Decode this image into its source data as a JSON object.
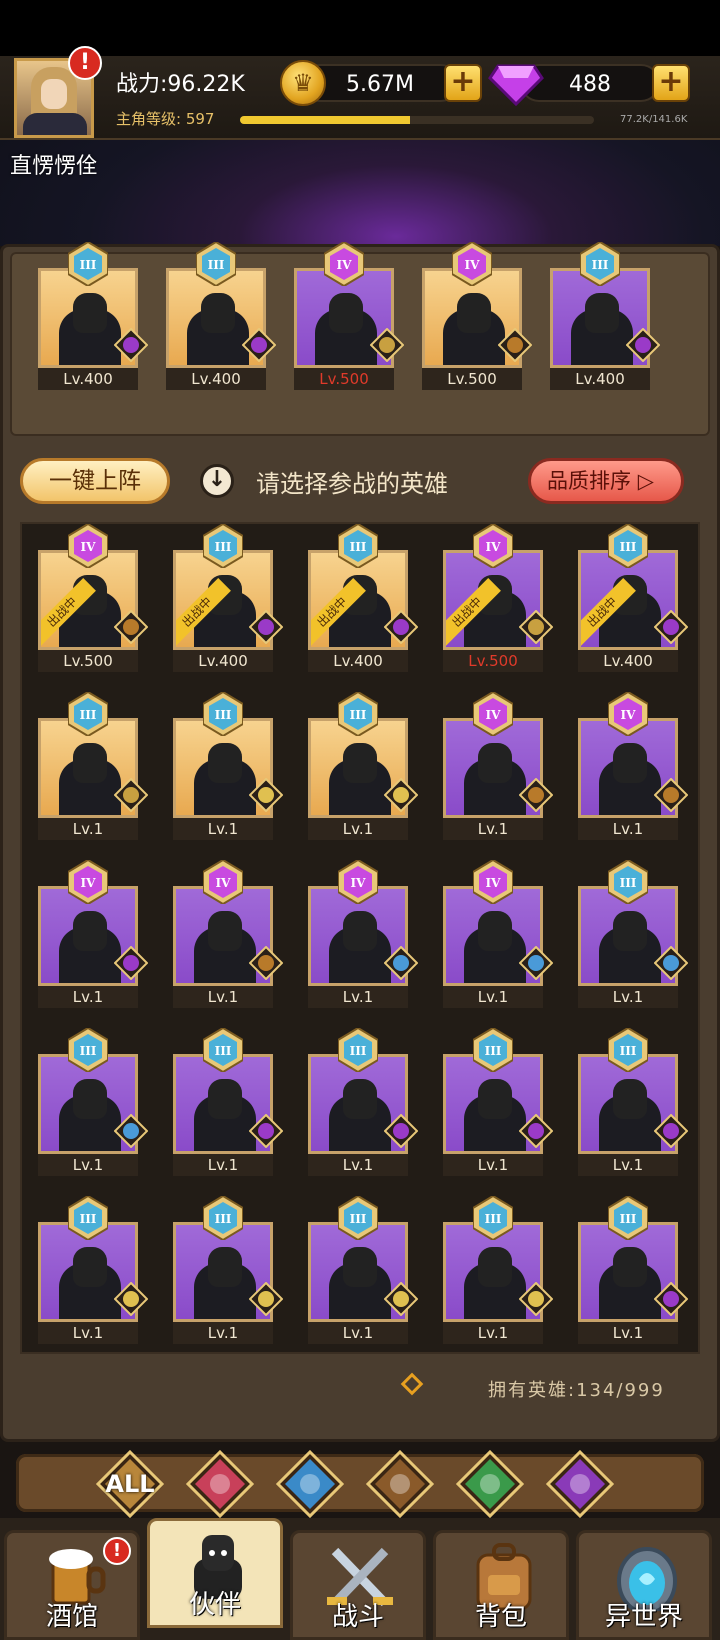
{
  "header": {
    "power_label": "战力:96.22K",
    "level_label": "主角等级: 597",
    "xp_progress": 0.48,
    "xp_text": "77.2K/141.6K",
    "gold": "5.67M",
    "gems": "488",
    "alert_mark": "!"
  },
  "player": {
    "name": "直愣愣佺"
  },
  "lineup": [
    {
      "rank": "III",
      "lv": "Lv.400",
      "frame": "gold",
      "faction": "demon",
      "lv_color": "normal"
    },
    {
      "rank": "III",
      "lv": "Lv.400",
      "frame": "gold",
      "faction": "demon",
      "lv_color": "normal"
    },
    {
      "rank": "IV",
      "lv": "Lv.500",
      "frame": "purple",
      "faction": "human",
      "lv_color": "red"
    },
    {
      "rank": "IV",
      "lv": "Lv.500",
      "frame": "gold",
      "faction": "beast",
      "lv_color": "normal"
    },
    {
      "rank": "III",
      "lv": "Lv.400",
      "frame": "purple",
      "faction": "demon",
      "lv_color": "normal"
    }
  ],
  "actions": {
    "auto_deploy": "一键上阵",
    "hint": "请选择参战的英雄",
    "sort": "品质排序"
  },
  "deployed_ribbon": "出战中",
  "heroes": [
    {
      "rank": "IV",
      "lv": "Lv.500",
      "frame": "gold",
      "faction": "beast",
      "deployed": true,
      "lv_color": "normal"
    },
    {
      "rank": "III",
      "lv": "Lv.400",
      "frame": "gold",
      "faction": "demon",
      "deployed": true,
      "lv_color": "normal"
    },
    {
      "rank": "III",
      "lv": "Lv.400",
      "frame": "gold",
      "faction": "demon",
      "deployed": true,
      "lv_color": "normal"
    },
    {
      "rank": "IV",
      "lv": "Lv.500",
      "frame": "purple",
      "faction": "human",
      "deployed": true,
      "lv_color": "red"
    },
    {
      "rank": "III",
      "lv": "Lv.400",
      "frame": "purple",
      "faction": "demon",
      "deployed": true,
      "lv_color": "normal"
    },
    {
      "rank": "III",
      "lv": "Lv.1",
      "frame": "gold",
      "faction": "human",
      "deployed": false,
      "lv_color": "normal"
    },
    {
      "rank": "III",
      "lv": "Lv.1",
      "frame": "gold",
      "faction": "elf",
      "deployed": false,
      "lv_color": "normal"
    },
    {
      "rank": "III",
      "lv": "Lv.1",
      "frame": "gold",
      "faction": "elf",
      "deployed": false,
      "lv_color": "normal"
    },
    {
      "rank": "IV",
      "lv": "Lv.1",
      "frame": "purple",
      "faction": "beast",
      "deployed": false,
      "lv_color": "normal"
    },
    {
      "rank": "IV",
      "lv": "Lv.1",
      "frame": "purple",
      "faction": "beast",
      "deployed": false,
      "lv_color": "normal"
    },
    {
      "rank": "IV",
      "lv": "Lv.1",
      "frame": "purple",
      "faction": "demon",
      "deployed": false,
      "lv_color": "normal"
    },
    {
      "rank": "IV",
      "lv": "Lv.1",
      "frame": "purple",
      "faction": "beast",
      "deployed": false,
      "lv_color": "normal"
    },
    {
      "rank": "IV",
      "lv": "Lv.1",
      "frame": "purple",
      "faction": "water",
      "deployed": false,
      "lv_color": "normal"
    },
    {
      "rank": "IV",
      "lv": "Lv.1",
      "frame": "purple",
      "faction": "water",
      "deployed": false,
      "lv_color": "normal"
    },
    {
      "rank": "III",
      "lv": "Lv.1",
      "frame": "purple",
      "faction": "water",
      "deployed": false,
      "lv_color": "normal"
    },
    {
      "rank": "III",
      "lv": "Lv.1",
      "frame": "purple",
      "faction": "water",
      "deployed": false,
      "lv_color": "normal"
    },
    {
      "rank": "III",
      "lv": "Lv.1",
      "frame": "purple",
      "faction": "demon",
      "deployed": false,
      "lv_color": "normal"
    },
    {
      "rank": "III",
      "lv": "Lv.1",
      "frame": "purple",
      "faction": "demon",
      "deployed": false,
      "lv_color": "normal"
    },
    {
      "rank": "III",
      "lv": "Lv.1",
      "frame": "purple",
      "faction": "demon",
      "deployed": false,
      "lv_color": "normal"
    },
    {
      "rank": "III",
      "lv": "Lv.1",
      "frame": "purple",
      "faction": "demon",
      "deployed": false,
      "lv_color": "normal"
    },
    {
      "rank": "III",
      "lv": "Lv.1",
      "frame": "purple",
      "faction": "elf",
      "deployed": false,
      "lv_color": "normal"
    },
    {
      "rank": "III",
      "lv": "Lv.1",
      "frame": "purple",
      "faction": "elf",
      "deployed": false,
      "lv_color": "normal"
    },
    {
      "rank": "III",
      "lv": "Lv.1",
      "frame": "purple",
      "faction": "elf",
      "deployed": false,
      "lv_color": "normal"
    },
    {
      "rank": "III",
      "lv": "Lv.1",
      "frame": "purple",
      "faction": "elf",
      "deployed": false,
      "lv_color": "normal"
    },
    {
      "rank": "III",
      "lv": "Lv.1",
      "frame": "purple",
      "faction": "demon",
      "deployed": false,
      "lv_color": "normal"
    }
  ],
  "owned": "拥有英雄:134/999",
  "filters": [
    {
      "label": "ALL",
      "icon": "all",
      "color": "#b8863a"
    },
    {
      "label": "",
      "icon": "human-helmet",
      "color": "#c8405a"
    },
    {
      "label": "",
      "icon": "water-creature",
      "color": "#3a8ac8"
    },
    {
      "label": "",
      "icon": "lion",
      "color": "#8a5a2a"
    },
    {
      "label": "",
      "icon": "elf",
      "color": "#3a9a4a"
    },
    {
      "label": "",
      "icon": "demon",
      "color": "#8a3ab8"
    }
  ],
  "nav": [
    {
      "label": "酒馆",
      "icon": "beer-mug",
      "active": false,
      "alert": true
    },
    {
      "label": "伙伴",
      "icon": "companion",
      "active": true,
      "alert": false
    },
    {
      "label": "战斗",
      "icon": "crossed-swords",
      "active": false,
      "alert": false
    },
    {
      "label": "背包",
      "icon": "backpack",
      "active": false,
      "alert": false
    },
    {
      "label": "异世界",
      "icon": "portal",
      "active": false,
      "alert": false
    }
  ],
  "colors": {
    "gold_frame": "#f7d38f",
    "purple_frame": "#a06ad8",
    "red_level": "#e03a2a",
    "xp_fill": "#f0c830"
  }
}
